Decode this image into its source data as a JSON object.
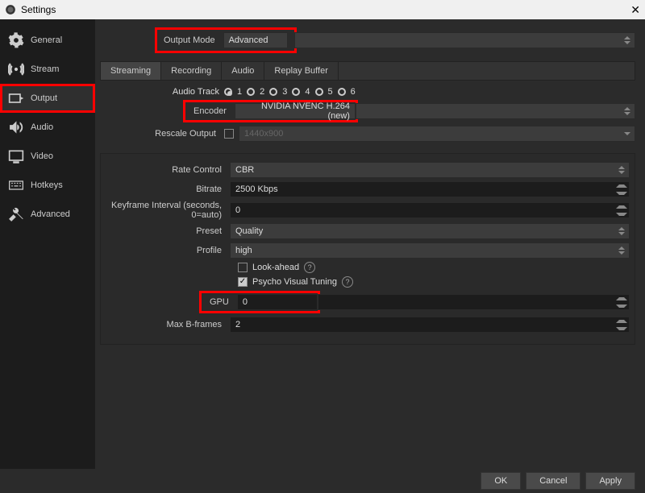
{
  "window": {
    "title": "Settings"
  },
  "sidebar": {
    "items": [
      {
        "label": "General"
      },
      {
        "label": "Stream"
      },
      {
        "label": "Output"
      },
      {
        "label": "Audio"
      },
      {
        "label": "Video"
      },
      {
        "label": "Hotkeys"
      },
      {
        "label": "Advanced"
      }
    ]
  },
  "output_mode": {
    "label": "Output Mode",
    "value": "Advanced"
  },
  "tabs": {
    "items": [
      {
        "label": "Streaming"
      },
      {
        "label": "Recording"
      },
      {
        "label": "Audio"
      },
      {
        "label": "Replay Buffer"
      }
    ]
  },
  "audio_track": {
    "label": "Audio Track",
    "options": [
      "1",
      "2",
      "3",
      "4",
      "5",
      "6"
    ],
    "selected": "1"
  },
  "encoder": {
    "label": "Encoder",
    "value": "NVIDIA NVENC H.264 (new)"
  },
  "rescale": {
    "label": "Rescale Output",
    "placeholder": "1440x900",
    "checked": false
  },
  "rate_control": {
    "label": "Rate Control",
    "value": "CBR"
  },
  "bitrate": {
    "label": "Bitrate",
    "value": "2500 Kbps"
  },
  "keyframe": {
    "label": "Keyframe Interval (seconds, 0=auto)",
    "value": "0"
  },
  "preset": {
    "label": "Preset",
    "value": "Quality"
  },
  "profile": {
    "label": "Profile",
    "value": "high"
  },
  "lookahead": {
    "label": "Look-ahead",
    "checked": false
  },
  "psycho": {
    "label": "Psycho Visual Tuning",
    "checked": true
  },
  "gpu": {
    "label": "GPU",
    "value": "0"
  },
  "max_bframes": {
    "label": "Max B-frames",
    "value": "2"
  },
  "footer": {
    "ok": "OK",
    "cancel": "Cancel",
    "apply": "Apply"
  }
}
